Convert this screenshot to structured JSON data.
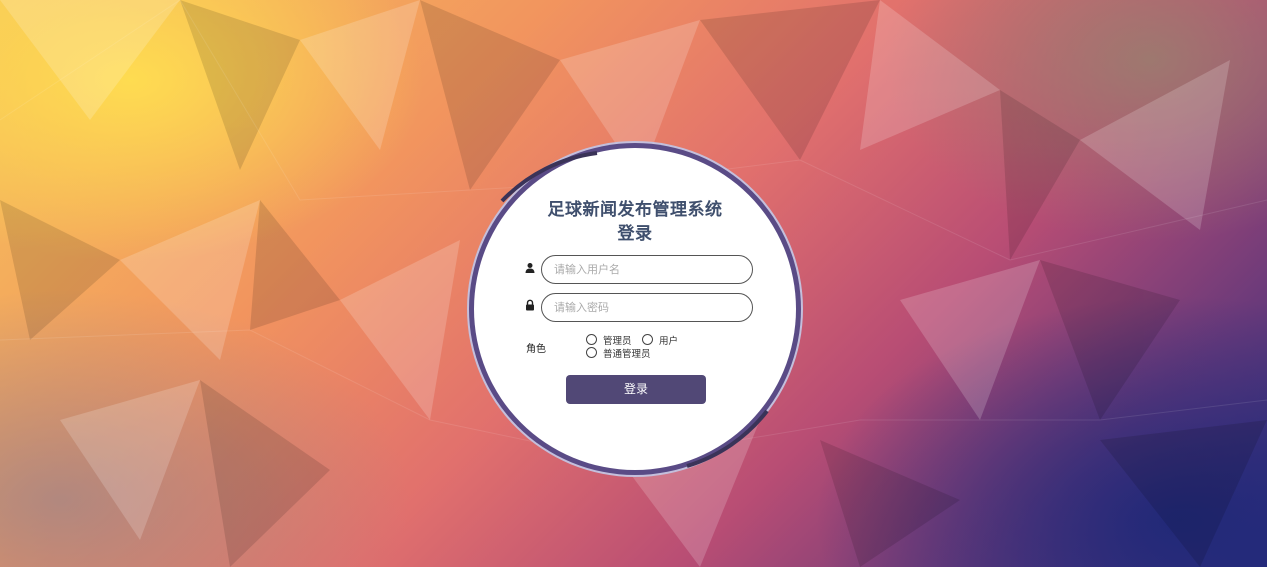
{
  "login": {
    "title_line1": "足球新闻发布管理系统",
    "title_line2": "登录",
    "username_placeholder": "请输入用户名",
    "password_placeholder": "请输入密码",
    "role_label": "角色",
    "roles": [
      "管理员",
      "用户",
      "普通管理员"
    ],
    "submit_label": "登录"
  },
  "colors": {
    "accent": "#514876",
    "ring": "#5a4b86",
    "title": "#3f4f6d"
  }
}
